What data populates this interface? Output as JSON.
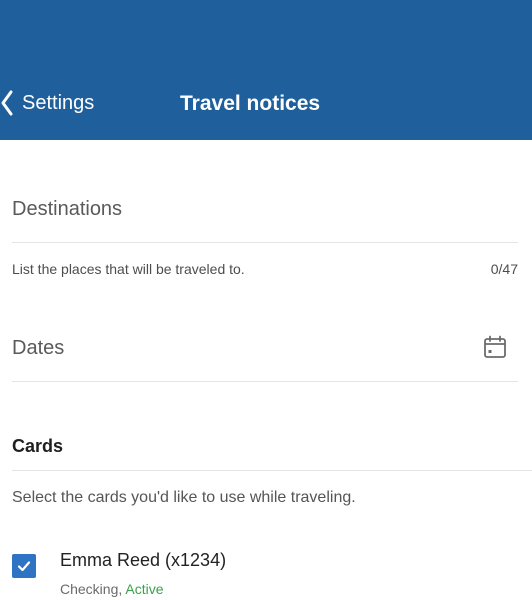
{
  "header": {
    "back_label": "Settings",
    "title": "Travel notices",
    "background": "#1f5f9c"
  },
  "destinations": {
    "label": "Destinations",
    "helper": "List the places that will be traveled to.",
    "counter": "0/47"
  },
  "dates": {
    "label": "Dates",
    "icon": "calendar-icon"
  },
  "cards": {
    "section_title": "Cards",
    "instruction": "Select the cards you'd like to use while traveling.",
    "items": [
      {
        "name": "Emma Reed (x1234)",
        "type": "Checking",
        "separator": ", ",
        "status": "Active",
        "selected": true,
        "status_color": "#3aa14a"
      }
    ]
  },
  "colors": {
    "checkbox": "#2f73c5"
  }
}
